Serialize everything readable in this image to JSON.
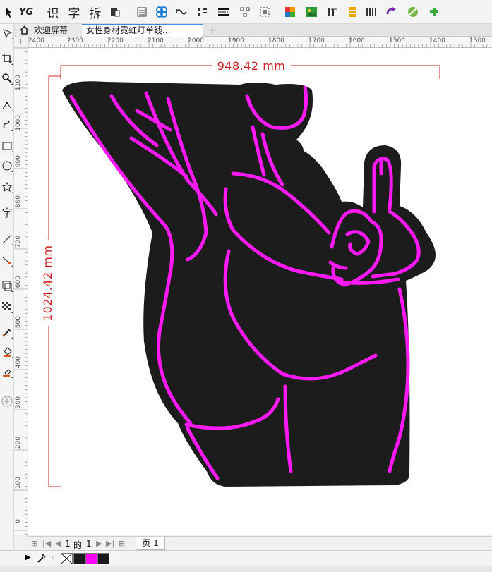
{
  "toolbar": {
    "yg_label": "YG",
    "recognize_label": "识",
    "char_label": "字",
    "split_label": "拆"
  },
  "tabs": {
    "welcome": "欢迎屏幕",
    "document": "女性身材霓虹灯单线..."
  },
  "ruler": {
    "horizontal": [
      "2400",
      "2300",
      "2200",
      "2100",
      "2000",
      "1900",
      "1800",
      "1700",
      "1600",
      "1500",
      "1400",
      "1300"
    ],
    "vertical": [
      "1100",
      "1000",
      "900",
      "800",
      "700",
      "600",
      "500",
      "400",
      "300",
      "200",
      "100",
      "0"
    ]
  },
  "dimensions": {
    "width": "948.42 mm",
    "height": "1024.42 mm"
  },
  "page_nav": {
    "current": "1",
    "of": "的",
    "total": "1",
    "page_tab": "页 1"
  },
  "colors": {
    "neon": "#ff19f5",
    "backing": "#1c1c1c",
    "dimension": "#d21f1f",
    "accent": "#3d8ee0"
  },
  "status": {
    "fill_swatch": "#ff00ff",
    "outline_swatch": "#1a1a1a"
  }
}
